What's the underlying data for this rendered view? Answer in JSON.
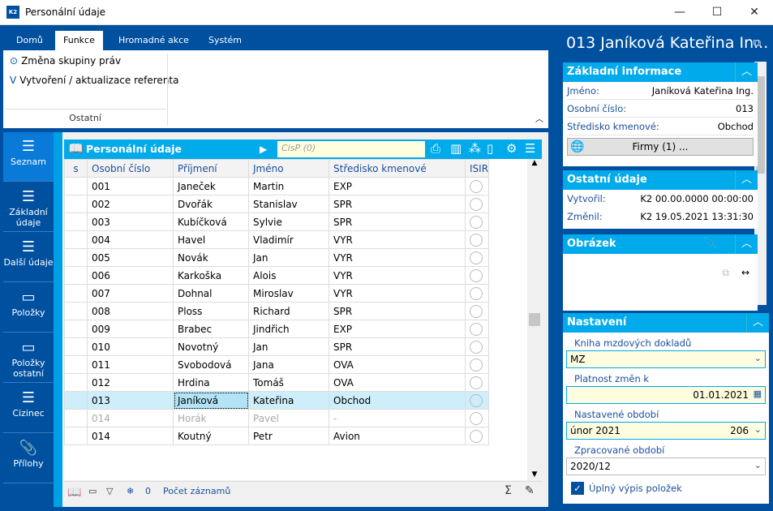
{
  "window": {
    "title": "Personální údaje",
    "logo": "K2",
    "minimize": "—",
    "maximize": "☐",
    "close": "✕"
  },
  "ribbon": {
    "tabs": [
      "Domů",
      "Funkce",
      "Hromadné akce",
      "Systém"
    ],
    "items": [
      "Změna skupiny práv",
      "Vytvoření / aktualizace referenta"
    ],
    "group": "Ostatní"
  },
  "sidebar": [
    "Seznam",
    "Základní údaje",
    "Další údaje",
    "Položky",
    "Položky ostatní",
    "Cizinec",
    "Přílohy"
  ],
  "grid": {
    "title": "Personální údaje",
    "search_placeholder": "CisP (0)",
    "columns": [
      "s",
      "Osobní číslo",
      "Příjmení",
      "Jméno",
      "Středisko kmenové",
      "ISIR"
    ],
    "rows": [
      [
        "001",
        "Janeček",
        "Martin",
        "EXP"
      ],
      [
        "002",
        "Dvořák",
        "Stanislav",
        "SPR"
      ],
      [
        "003",
        "Kubíčková",
        "Sylvie",
        "SPR"
      ],
      [
        "004",
        "Havel",
        "Vladimír",
        "VYR"
      ],
      [
        "005",
        "Novák",
        "Jan",
        "VYR"
      ],
      [
        "006",
        "Karkoška",
        "Alois",
        "VYR"
      ],
      [
        "007",
        "Dohnal",
        "Miroslav",
        "VYR"
      ],
      [
        "008",
        "Ploss",
        "Richard",
        "SPR"
      ],
      [
        "009",
        "Brabec",
        "Jindřich",
        "EXP"
      ],
      [
        "010",
        "Novotný",
        "Jan",
        "SPR"
      ],
      [
        "011",
        "Svobodová",
        "Jana",
        "OVA"
      ],
      [
        "012",
        "Hrdina",
        "Tomáš",
        "OVA"
      ],
      [
        "013",
        "Janíková",
        "Kateřina",
        "Obchod"
      ],
      [
        "014",
        "Horák",
        "Pavel",
        "-"
      ],
      [
        "014",
        "Koutný",
        "Petr",
        "Avion"
      ]
    ],
    "selected_row": 12,
    "disabled_row": 13
  },
  "status": {
    "count": "0",
    "label": "Počet záznamů"
  },
  "detail": {
    "title": "013 Janíková Kateřina In...",
    "basic": {
      "header": "Základní informace",
      "name_label": "Jméno:",
      "name": "Janíková Kateřina Ing.",
      "num_label": "Osobní číslo:",
      "num": "013",
      "center_label": "Středisko kmenové:",
      "center": "Obchod",
      "firms_button": "Firmy (1) ..."
    },
    "other": {
      "header": "Ostatní údaje",
      "created_label": "Vytvořil:",
      "created": "K2 00.00.0000 00:00:00",
      "changed_label": "Změnil:",
      "changed": "K2 19.05.2021 13:31:30"
    },
    "image": {
      "header": "Obrázek"
    },
    "settings": {
      "header": "Nastavení",
      "book_label": "Kniha mzdových dokladů",
      "book": "MZ",
      "valid_label": "Platnost změn k",
      "valid": "01.01.2021",
      "period_label": "Nastavené období",
      "period": "únor 2021",
      "period_num": "206",
      "processed_label": "Zpracované období",
      "processed": "2020/12",
      "full_list_label": "Úplný výpis položek"
    }
  }
}
